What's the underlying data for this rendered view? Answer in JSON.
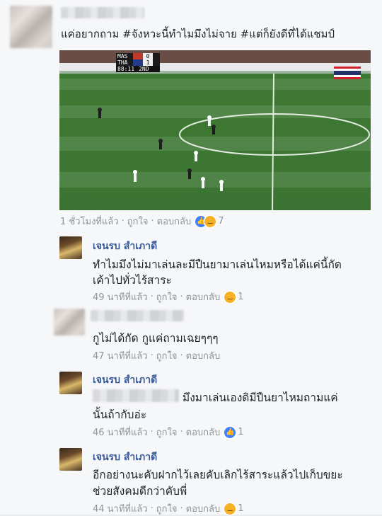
{
  "post": {
    "text": "แค่อยากถาม #จังหวะนี้ทำไมมึงไม่จาย #แต่ก็ยังดีที่ได้แชมป์",
    "time": "1 ชั่วโมงที่แล้ว",
    "like_label": "ถูกใจ",
    "reply_label": "ตอบกลับ",
    "reaction_count": "7"
  },
  "scoreboard": {
    "team1": "MAS",
    "team2": "THA",
    "score1": "0",
    "score2": "1",
    "clock": "88:11",
    "period": "2ND"
  },
  "comments": [
    {
      "author": "เจนรบ สำเภาดี",
      "lines": [
        "ทำไมมึงไม่มาเล่นละมีปืนยามาเล่นไหมหรือได้แค่นี้กัด",
        "เค้าไปทั่วไร้สาระ"
      ],
      "time": "49 นาทีที่แล้ว",
      "reaction_count": "1"
    },
    {
      "author": "",
      "lines": [
        "กูไม่ได้กัด กูแค่ถามเฉยๆๆๆ"
      ],
      "time": "47 นาทีที่แล้ว"
    },
    {
      "author": "เจนรบ สำเภาดี",
      "lines": [
        "มึงมาเล่นเองดิมีปืนยาไหมถามแค่",
        "นั้นถ้ากับอ่ะ"
      ],
      "time": "46 นาทีที่แล้ว",
      "reaction_count": "1"
    },
    {
      "author": "เจนรบ สำเภาดี",
      "lines": [
        "อีกอย่างนะคับฝากไว้เลยคับเลิกไร้สาระแล้วไปเก็บขยะ",
        "ช่วยสังคมดีกว่าคับพี่"
      ],
      "time": "44 นาทีที่แล้ว",
      "reaction_count": "1"
    }
  ],
  "labels": {
    "like": "ถูกใจ",
    "reply": "ตอบกลับ",
    "dot": "·"
  },
  "colors": {
    "link": "#365899",
    "meta": "#90949c",
    "text": "#1d2129",
    "pitch": "#2f6b2a"
  }
}
